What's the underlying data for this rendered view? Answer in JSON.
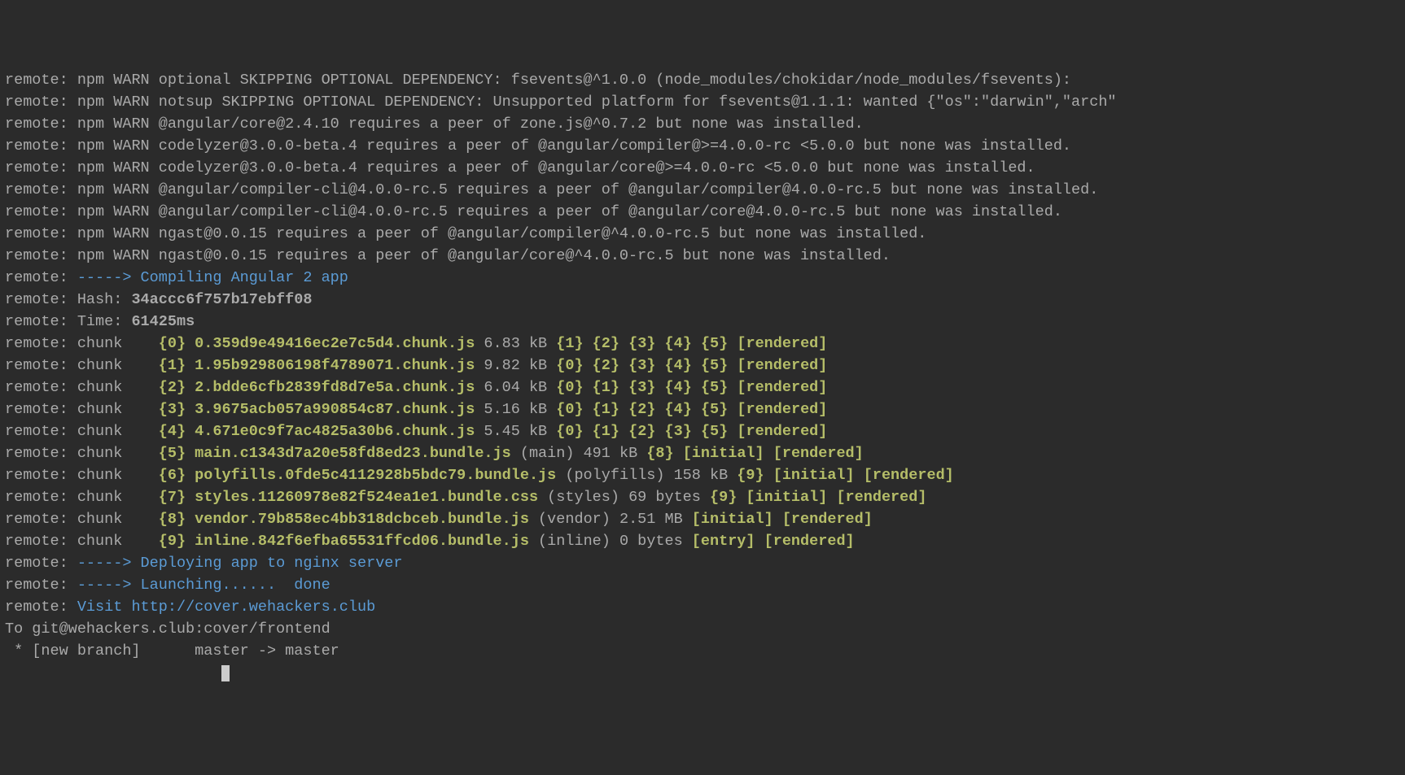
{
  "prefix": "remote:",
  "warns": [
    "npm WARN optional SKIPPING OPTIONAL DEPENDENCY: fsevents@^1.0.0 (node_modules/chokidar/node_modules/fsevents):",
    "npm WARN notsup SKIPPING OPTIONAL DEPENDENCY: Unsupported platform for fsevents@1.1.1: wanted {\"os\":\"darwin\",\"arch\"",
    "npm WARN @angular/core@2.4.10 requires a peer of zone.js@^0.7.2 but none was installed.",
    "npm WARN codelyzer@3.0.0-beta.4 requires a peer of @angular/compiler@>=4.0.0-rc <5.0.0 but none was installed.",
    "npm WARN codelyzer@3.0.0-beta.4 requires a peer of @angular/core@>=4.0.0-rc <5.0.0 but none was installed.",
    "npm WARN @angular/compiler-cli@4.0.0-rc.5 requires a peer of @angular/compiler@4.0.0-rc.5 but none was installed.",
    "npm WARN @angular/compiler-cli@4.0.0-rc.5 requires a peer of @angular/core@4.0.0-rc.5 but none was installed.",
    "npm WARN ngast@0.0.15 requires a peer of @angular/compiler@^4.0.0-rc.5 but none was installed.",
    "npm WARN ngast@0.0.15 requires a peer of @angular/core@^4.0.0-rc.5 but none was installed."
  ],
  "steps": {
    "arrow": "----->",
    "compile": "Compiling Angular 2 app",
    "deploy": "Deploying app to nginx server",
    "launch": "Launching......",
    "done": "done"
  },
  "hash_label": "Hash:",
  "hash_value": "34accc6f757b17ebff08",
  "time_label": "Time:",
  "time_value": "61425ms",
  "chunk_label": "chunk",
  "chunks": [
    {
      "id": "{0}",
      "file": "0.359d9e49416ec2e7c5d4.chunk.js",
      "meta": "6.83 kB",
      "deps": [
        "{1}",
        "{2}",
        "{3}",
        "{4}",
        "{5}"
      ],
      "tags": [
        "[rendered]"
      ]
    },
    {
      "id": "{1}",
      "file": "1.95b929806198f4789071.chunk.js",
      "meta": "9.82 kB",
      "deps": [
        "{0}",
        "{2}",
        "{3}",
        "{4}",
        "{5}"
      ],
      "tags": [
        "[rendered]"
      ]
    },
    {
      "id": "{2}",
      "file": "2.bdde6cfb2839fd8d7e5a.chunk.js",
      "meta": "6.04 kB",
      "deps": [
        "{0}",
        "{1}",
        "{3}",
        "{4}",
        "{5}"
      ],
      "tags": [
        "[rendered]"
      ]
    },
    {
      "id": "{3}",
      "file": "3.9675acb057a990854c87.chunk.js",
      "meta": "5.16 kB",
      "deps": [
        "{0}",
        "{1}",
        "{2}",
        "{4}",
        "{5}"
      ],
      "tags": [
        "[rendered]"
      ]
    },
    {
      "id": "{4}",
      "file": "4.671e0c9f7ac4825a30b6.chunk.js",
      "meta": "5.45 kB",
      "deps": [
        "{0}",
        "{1}",
        "{2}",
        "{3}",
        "{5}"
      ],
      "tags": [
        "[rendered]"
      ]
    },
    {
      "id": "{5}",
      "file": "main.c1343d7a20e58fd8ed23.bundle.js",
      "meta": "(main) 491 kB",
      "deps": [
        "{8}"
      ],
      "tags": [
        "[initial]",
        "[rendered]"
      ]
    },
    {
      "id": "{6}",
      "file": "polyfills.0fde5c4112928b5bdc79.bundle.js",
      "meta": "(polyfills) 158 kB",
      "deps": [
        "{9}"
      ],
      "tags": [
        "[initial]",
        "[rendered]"
      ]
    },
    {
      "id": "{7}",
      "file": "styles.11260978e82f524ea1e1.bundle.css",
      "meta": "(styles) 69 bytes",
      "deps": [
        "{9}"
      ],
      "tags": [
        "[initial]",
        "[rendered]"
      ]
    },
    {
      "id": "{8}",
      "file": "vendor.79b858ec4bb318dcbceb.bundle.js",
      "meta": "(vendor) 2.51 MB",
      "deps": [],
      "tags": [
        "[initial]",
        "[rendered]"
      ]
    },
    {
      "id": "{9}",
      "file": "inline.842f6efba65531ffcd06.bundle.js",
      "meta": "(inline) 0 bytes",
      "deps": [],
      "tags": [
        "[entry]",
        "[rendered]"
      ]
    }
  ],
  "visit_label": "Visit",
  "visit_url": "http://cover.wehackers.club",
  "push_to": "To git@wehackers.club:cover/frontend",
  "push_branch": " * [new branch]      master -> master"
}
